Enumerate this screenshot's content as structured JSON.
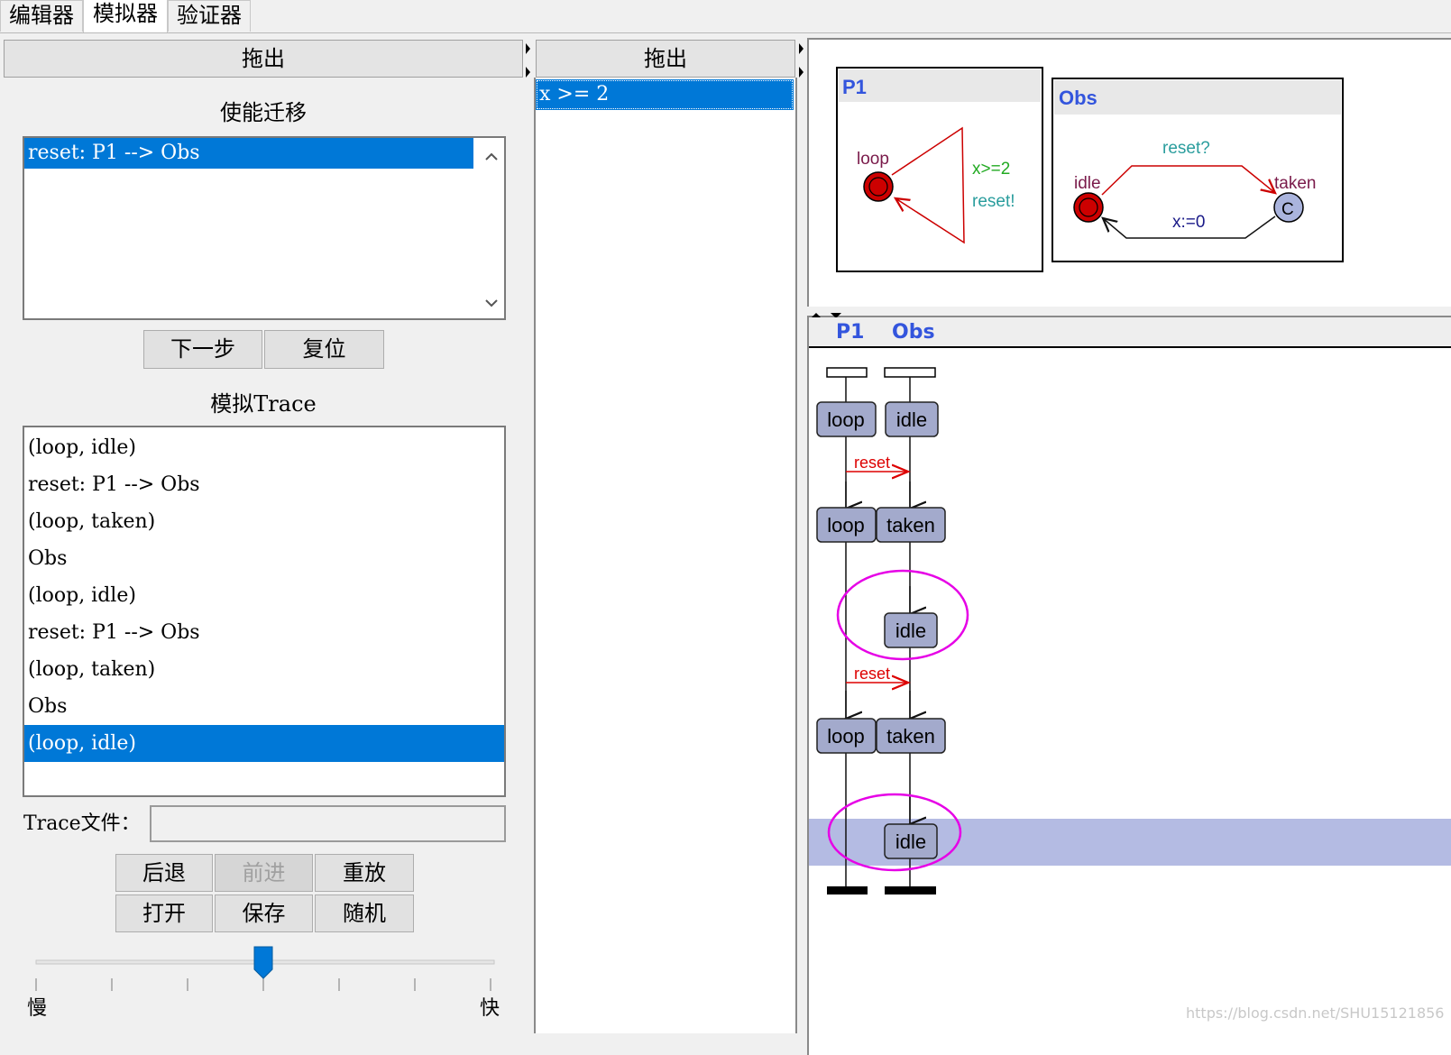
{
  "tabs": [
    "编辑器",
    "模拟器",
    "验证器"
  ],
  "left_panel": {
    "header": "拖出",
    "enabled_transitions_title": "使能迁移",
    "enabled_transitions": [
      "reset: P1 --> Obs"
    ],
    "next_button": "下一步",
    "reset_button": "复位",
    "trace_title": "模拟Trace",
    "trace_items": [
      "(loop, idle)",
      "reset: P1 --> Obs",
      "(loop, taken)",
      "Obs",
      "(loop, idle)",
      "reset: P1 --> Obs",
      "(loop, taken)",
      "Obs",
      "(loop, idle)"
    ],
    "selected_trace_index": 8,
    "trace_file_label": "Trace文件：",
    "trace_file_value": "",
    "buttons": {
      "back": "后退",
      "forward": "前进",
      "replay": "重放",
      "open": "打开",
      "save": "保存",
      "random": "随机"
    },
    "speed_slow": "慢",
    "speed_fast": "快",
    "speed_value": 0.5
  },
  "middle_panel": {
    "header": "拖出",
    "variables": [
      "x >= 2"
    ]
  },
  "automata": {
    "p1": {
      "name": "P1",
      "location": "loop",
      "guard": "x>=2",
      "sync": "reset!"
    },
    "obs": {
      "name": "Obs",
      "location_idle": "idle",
      "location_taken": "taken",
      "committed_mark": "C",
      "sync": "reset?",
      "assign": "x:=0"
    }
  },
  "msc": {
    "processes": [
      "P1",
      "Obs"
    ],
    "p1_states": [
      "loop",
      "loop",
      "loop"
    ],
    "obs_states": [
      "idle",
      "taken",
      "idle",
      "taken",
      "idle"
    ],
    "messages": [
      "reset",
      "reset"
    ]
  },
  "colors": {
    "selection": "#0078d7",
    "process_name": "#3355dd",
    "location_red": "#cc0000",
    "committed_fill": "#aab4dd",
    "guard_green": "#22aa22",
    "sync_teal": "#2a9d9d",
    "assign_navy": "#1a1a88",
    "location_label": "#7a1a4a",
    "msc_state_fill": "#a3aacc",
    "msc_highlight": "#b4bbe3",
    "msc_message": "#dd0000",
    "annotation_circle": "#e600e6"
  },
  "watermark": "https://blog.csdn.net/SHU15121856"
}
